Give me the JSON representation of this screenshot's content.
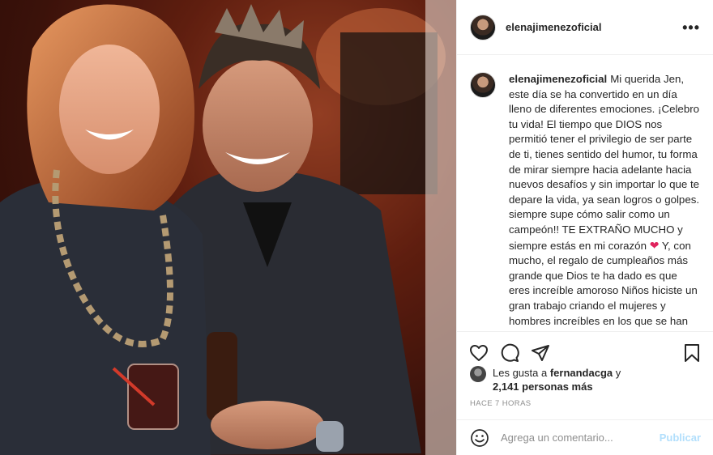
{
  "post": {
    "photo_icon": "portrait-photo",
    "header": {
      "username": "elenajimenezoficial",
      "more_icon": "more-horizontal-icon",
      "more_label": "•••"
    },
    "caption": {
      "username": "elenajimenezoficial",
      "text_part1": "Mi querida Jen, este día se ha convertido en un día lleno de diferentes emociones. ¡Celebro tu vida! El tiempo que DIOS nos permitió tener el privilegio de ser parte de ti, tienes sentido del humor, tu forma de mirar siempre hacia adelante hacia nuevos desafíos y sin importar lo que te depare la vida, ya sean logros o golpes. siempre supe cómo salir como un campeón!!  TE EXTRAÑO MUCHO y siempre estás en mi corazón",
      "heart": "❤",
      "text_part2": " Y, con mucho, el regalo de cumpleaños más grande que Dios te ha dado es que eres increíble amoroso Niños hiciste un gran trabajo criando el mujeres y hombres increíbles en los que se han convertido y ustedes son hermosos"
    },
    "actions": {
      "like_icon": "heart-icon",
      "comment_icon": "comment-icon",
      "share_icon": "share-icon",
      "save_icon": "bookmark-icon"
    },
    "likes": {
      "prefix": "Les gusta a ",
      "user": "fernandacga",
      "conj": " y",
      "count": "2,141 personas más"
    },
    "timestamp": "HACE 7 HORAS",
    "comment_box": {
      "emoji_icon": "emoji-icon",
      "placeholder": "Agrega un comentario...",
      "post_label": "Publicar"
    },
    "colors": {
      "heart_red": "#e0245e",
      "post_disabled": "#b2dffc",
      "muted": "#8e8e8e"
    }
  }
}
